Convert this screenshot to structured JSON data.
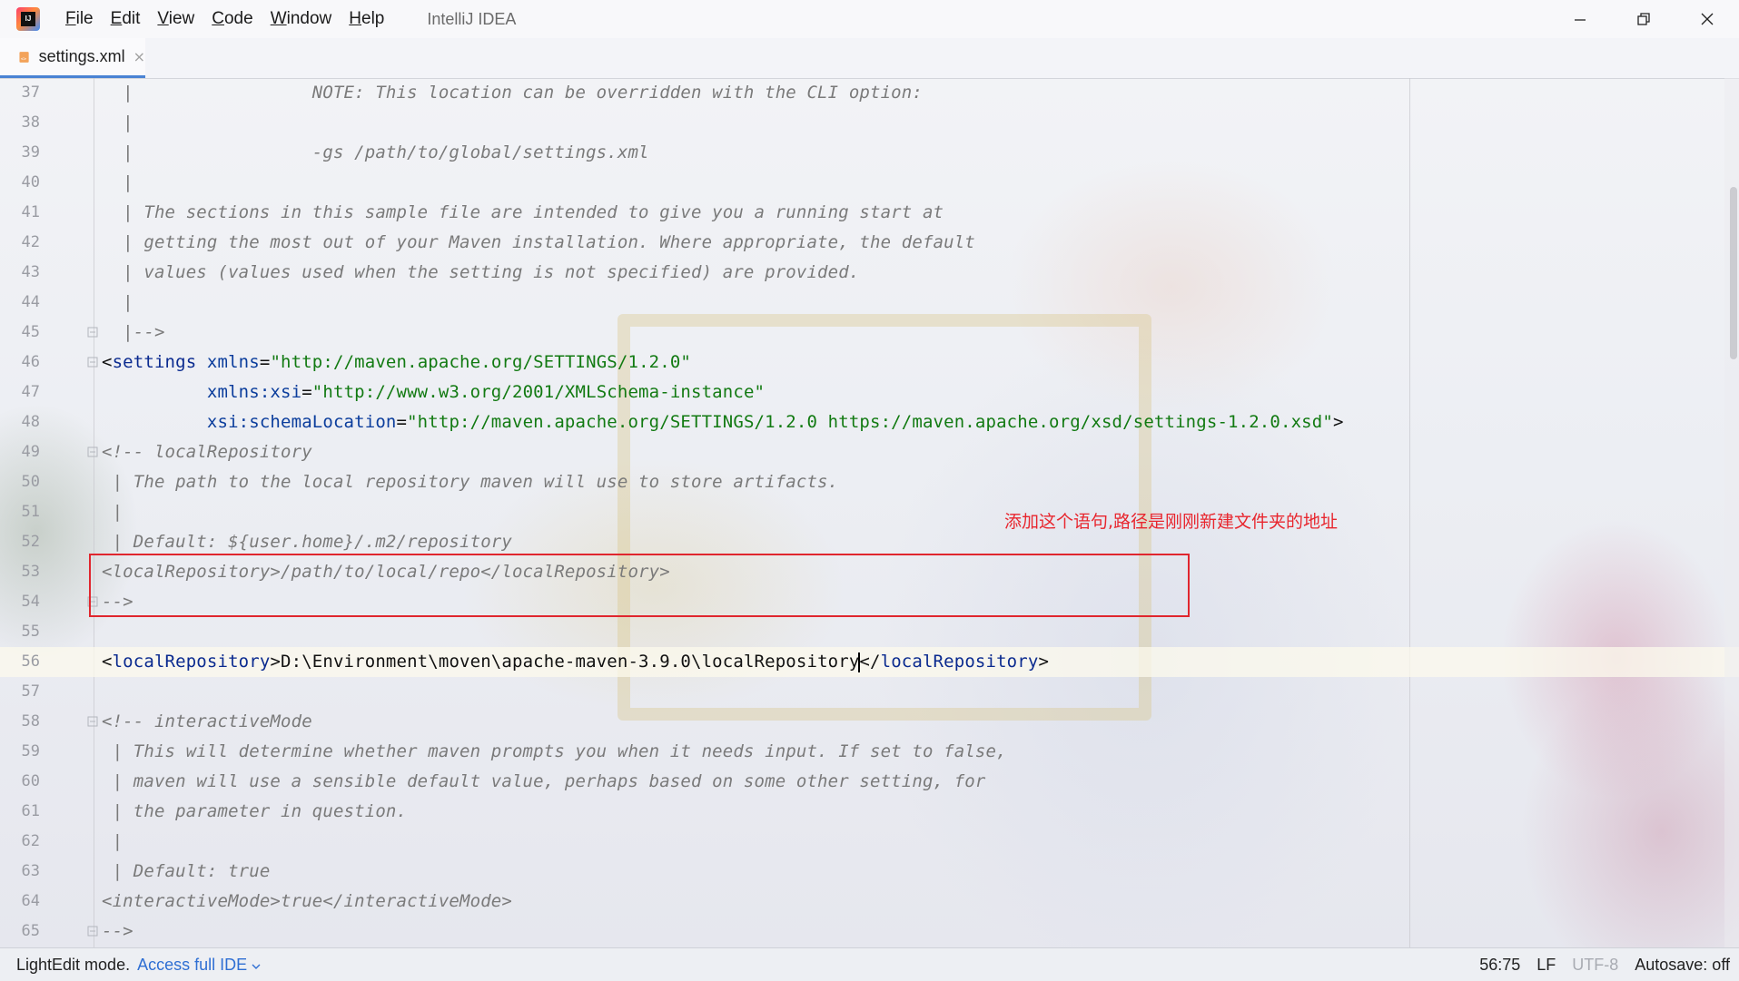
{
  "titlebar": {
    "menus": [
      {
        "label": "File",
        "mnemonic": "F",
        "rest": "ile"
      },
      {
        "label": "Edit",
        "mnemonic": "E",
        "rest": "dit"
      },
      {
        "label": "View",
        "mnemonic": "V",
        "rest": "iew"
      },
      {
        "label": "Code",
        "mnemonic": "C",
        "rest": "ode"
      },
      {
        "label": "Window",
        "mnemonic": "W",
        "rest": "indow"
      },
      {
        "label": "Help",
        "mnemonic": "H",
        "rest": "elp"
      }
    ],
    "app_title": "IntelliJ IDEA",
    "logo_text": "IJ"
  },
  "tab": {
    "label": "settings.xml",
    "close": "×"
  },
  "editor": {
    "lines": [
      {
        "num": "37",
        "segments": [
          {
            "c": "cmt",
            "t": "  |                 NOTE: This location can be overridden with the CLI option:"
          }
        ]
      },
      {
        "num": "38",
        "segments": [
          {
            "c": "cmt",
            "t": "  |"
          }
        ]
      },
      {
        "num": "39",
        "segments": [
          {
            "c": "cmt",
            "t": "  |                 -gs /path/to/global/settings.xml"
          }
        ]
      },
      {
        "num": "40",
        "segments": [
          {
            "c": "cmt",
            "t": "  |"
          }
        ]
      },
      {
        "num": "41",
        "segments": [
          {
            "c": "cmt",
            "t": "  | The sections in this sample file are intended to give you a running start at"
          }
        ]
      },
      {
        "num": "42",
        "segments": [
          {
            "c": "cmt",
            "t": "  | getting the most out of your Maven installation. Where appropriate, the default"
          }
        ]
      },
      {
        "num": "43",
        "segments": [
          {
            "c": "cmt",
            "t": "  | values (values used when the setting is not specified) are provided."
          }
        ]
      },
      {
        "num": "44",
        "segments": [
          {
            "c": "cmt",
            "t": "  |"
          }
        ]
      },
      {
        "num": "45",
        "segments": [
          {
            "c": "cmt",
            "t": "  |-->"
          }
        ],
        "fold": true
      },
      {
        "num": "46",
        "segments": [
          {
            "c": "plain",
            "t": "<"
          },
          {
            "c": "tag",
            "t": "settings"
          },
          {
            "c": "plain",
            "t": " "
          },
          {
            "c": "attr",
            "t": "xmlns"
          },
          {
            "c": "plain",
            "t": "="
          },
          {
            "c": "str",
            "t": "\"http://maven.apache.org/SETTINGS/1.2.0\""
          }
        ],
        "fold": true,
        "indent": -1
      },
      {
        "num": "47",
        "segments": [
          {
            "c": "plain",
            "t": "          "
          },
          {
            "c": "attr",
            "t": "xmlns:xsi"
          },
          {
            "c": "plain",
            "t": "="
          },
          {
            "c": "str",
            "t": "\"http://www.w3.org/2001/XMLSchema-instance\""
          }
        ],
        "indent": -1
      },
      {
        "num": "48",
        "segments": [
          {
            "c": "plain",
            "t": "          "
          },
          {
            "c": "attr",
            "t": "xsi:schemaLocation"
          },
          {
            "c": "plain",
            "t": "="
          },
          {
            "c": "str",
            "t": "\"http://maven.apache.org/SETTINGS/1.2.0 https://maven.apache.org/xsd/settings-1.2.0.xsd\""
          },
          {
            "c": "plain",
            "t": ">"
          }
        ],
        "indent": -1
      },
      {
        "num": "49",
        "segments": [
          {
            "c": "cmt",
            "t": "<!-- localRepository"
          }
        ],
        "fold": true
      },
      {
        "num": "50",
        "segments": [
          {
            "c": "cmt",
            "t": " | The path to the local repository maven will use to store artifacts."
          }
        ]
      },
      {
        "num": "51",
        "segments": [
          {
            "c": "cmt",
            "t": " |"
          }
        ]
      },
      {
        "num": "52",
        "segments": [
          {
            "c": "cmt",
            "t": " | Default: ${user.home}/.m2/repository"
          }
        ]
      },
      {
        "num": "53",
        "segments": [
          {
            "c": "cmt",
            "t": "<localRepository>/path/to/local/repo</localRepository>"
          }
        ]
      },
      {
        "num": "54",
        "segments": [
          {
            "c": "cmt",
            "t": "-->"
          }
        ],
        "fold": true
      },
      {
        "num": "55",
        "segments": []
      },
      {
        "num": "56",
        "segments": [
          {
            "c": "plain",
            "t": "<"
          },
          {
            "c": "tag",
            "t": "localRepository"
          },
          {
            "c": "plain",
            "t": ">D:\\Environment\\moven\\apache-maven-3.9.0\\localRepository"
          },
          {
            "c": "caret",
            "t": ""
          },
          {
            "c": "plain",
            "t": "</"
          },
          {
            "c": "tag",
            "t": "localRepository"
          },
          {
            "c": "plain",
            "t": ">"
          }
        ],
        "current": true
      },
      {
        "num": "57",
        "segments": []
      },
      {
        "num": "58",
        "segments": [
          {
            "c": "cmt",
            "t": "<!-- interactiveMode"
          }
        ],
        "fold": true
      },
      {
        "num": "59",
        "segments": [
          {
            "c": "cmt",
            "t": " | This will determine whether maven prompts you when it needs input. If set to false,"
          }
        ]
      },
      {
        "num": "60",
        "segments": [
          {
            "c": "cmt",
            "t": " | maven will use a sensible default value, perhaps based on some other setting, for"
          }
        ]
      },
      {
        "num": "61",
        "segments": [
          {
            "c": "cmt",
            "t": " | the parameter in question."
          }
        ]
      },
      {
        "num": "62",
        "segments": [
          {
            "c": "cmt",
            "t": " |"
          }
        ]
      },
      {
        "num": "63",
        "segments": [
          {
            "c": "cmt",
            "t": " | Default: true"
          }
        ]
      },
      {
        "num": "64",
        "segments": [
          {
            "c": "cmt",
            "t": "<interactiveMode>true</interactiveMode>"
          }
        ]
      },
      {
        "num": "65",
        "segments": [
          {
            "c": "cmt",
            "t": "-->"
          }
        ],
        "fold": true
      }
    ],
    "annotation": "添加这个语句,路径是刚刚新建文件夹的地址"
  },
  "statusbar": {
    "mode": "LightEdit mode.",
    "link": "Access full IDE",
    "position": "56:75",
    "line_sep": "LF",
    "encoding": "UTF-8",
    "autosave": "Autosave: off"
  }
}
